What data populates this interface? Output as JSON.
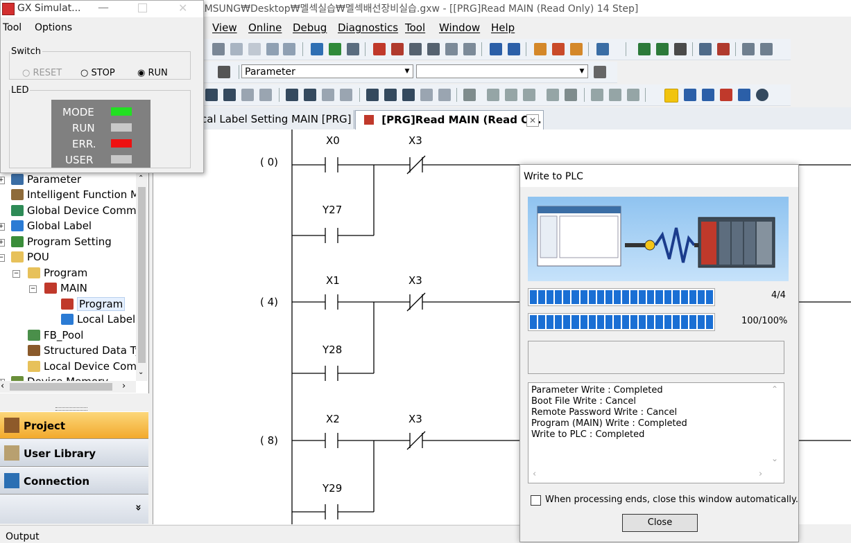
{
  "window": {
    "title": "AMSUNG₩Desktop₩멜섹실습₩멜섹배선장비실습.gxw - [[PRG]Read MAIN (Read Only) 14 Step]"
  },
  "menu": [
    "View",
    "Online",
    "Debug",
    "Diagnostics",
    "Tool",
    "Window",
    "Help"
  ],
  "toolbar": {
    "label_combo": "Parameter"
  },
  "tabs": [
    {
      "label": "cal Label Setting MAIN [PRG]",
      "active": false
    },
    {
      "label": "[PRG]Read MAIN (Read O...",
      "active": true
    }
  ],
  "simulator": {
    "title": "GX Simulat...",
    "menu": [
      "Tool",
      "Options"
    ],
    "switch_group": "Switch",
    "switch_options": [
      "RESET",
      "STOP",
      "RUN"
    ],
    "switch_selected": "RUN",
    "led_group": "LED",
    "leds": [
      {
        "label": "MODE",
        "color": "#22e022"
      },
      {
        "label": "RUN",
        "color": "#c8c8c8"
      },
      {
        "label": "ERR.",
        "color": "#ee1010"
      },
      {
        "label": "USER",
        "color": "#c8c8c8"
      }
    ]
  },
  "tree": [
    "Parameter",
    "Intelligent Function M",
    "Global Device Comme",
    "Global Label",
    "Program Setting",
    "POU",
    "Program",
    "MAIN",
    "Program",
    "Local Label",
    "FB_Pool",
    "Structured Data Ty",
    "Local Device Comr",
    "Device Memory"
  ],
  "nav": {
    "project": "Project",
    "user_library": "User Library",
    "connection": "Connection Destination",
    "more": "»"
  },
  "ladder": {
    "rungs": [
      {
        "step": "(    0)",
        "contact": "X0",
        "nc": "X3",
        "parallel": "Y27"
      },
      {
        "step": "(    4)",
        "contact": "X1",
        "nc": "X3",
        "parallel": "Y28"
      },
      {
        "step": "(    8)",
        "contact": "X2",
        "nc": "X3",
        "parallel": "Y29"
      }
    ]
  },
  "dialog": {
    "title": "Write to PLC",
    "progress1_text": "4/4",
    "progress1_value": 1.0,
    "progress2_text": "100/100%",
    "progress2_value": 1.0,
    "log": [
      "Parameter Write : Completed",
      "Boot File Write : Cancel",
      "Remote Password Write : Cancel",
      "Program (MAIN) Write : Completed",
      "Write to PLC : Completed"
    ],
    "auto_close_label": "When processing ends, close this window automatically.",
    "close_button": "Close"
  },
  "status": {
    "output_label": "Output"
  }
}
